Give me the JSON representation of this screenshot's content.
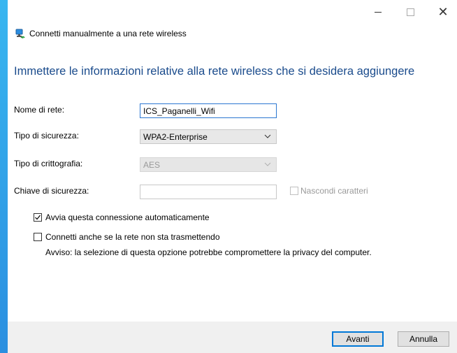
{
  "window": {
    "title": "Connetti manualmente a una rete wireless",
    "controls": {
      "minimize": "–",
      "maximize": "□",
      "close": "✕"
    }
  },
  "instruction": "Immettere le informazioni relative alla rete wireless che si desidera aggiungere",
  "form": {
    "network_name": {
      "label": "Nome di rete:",
      "value": "ICS_Paganelli_Wifi"
    },
    "security_type": {
      "label": "Tipo di sicurezza:",
      "value": "WPA2-Enterprise"
    },
    "encryption_type": {
      "label": "Tipo di crittografia:",
      "value": "AES",
      "disabled": true
    },
    "security_key": {
      "label": "Chiave di sicurezza:",
      "value": ""
    },
    "hide_chars": {
      "label": "Nascondi caratteri",
      "checked": false,
      "disabled": true
    },
    "auto_connect": {
      "label": "Avvia questa connessione automaticamente",
      "checked": true
    },
    "connect_hidden": {
      "label": "Connetti anche se la rete non sta trasmettendo",
      "checked": false
    },
    "warning": "Avviso: la selezione di questa opzione potrebbe compromettere la privacy del computer."
  },
  "buttons": {
    "next": "Avanti",
    "cancel": "Annulla"
  },
  "icons": {
    "header": "wireless-network-icon",
    "chevron": "chevron-down-icon",
    "check": "checkmark-icon"
  },
  "colors": {
    "accent": "#1a4b8c",
    "focus_border": "#2b77d1",
    "desktop": "#2b8fe0"
  }
}
